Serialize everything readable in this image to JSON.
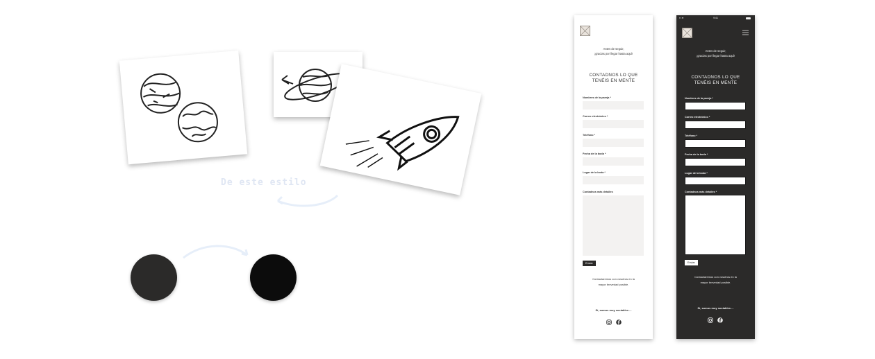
{
  "canvas": {
    "faint_label": "De este estilo"
  },
  "colors": {
    "circle_dark_gray": "#2b2a29",
    "circle_black": "#0c0c0c",
    "dark_background": "#2b2a29",
    "light_background": "#ffffff",
    "input_light": "#f3f2f1",
    "arrow_color": "#e8eef8"
  },
  "form": {
    "intro": [
      "Antes de seguir,",
      "¡gracias por llegar hasta aquí!"
    ],
    "title": [
      "CONTADNOS LO QUE",
      "TENÉIS EN MENTE"
    ],
    "fields": [
      {
        "label": "Nombres de la pareja *"
      },
      {
        "label": "Correo electrónico *"
      },
      {
        "label": "Teléfono *"
      },
      {
        "label": "Fecha de la boda *"
      },
      {
        "label": "Lugar de la boda *"
      }
    ],
    "textarea_label": "Contadnos más detalles",
    "textarea_label_dark": "Contadnos más detalles *",
    "send_label": "Enviar",
    "contact_text": [
      "Contactaremos con vosotros en la",
      "mayor brevedad posible."
    ],
    "social_text": "Sí, somos muy sociables ...",
    "social_icons": [
      "instagram-icon",
      "facebook-icon"
    ]
  },
  "statusbar": {
    "time": "9:41"
  }
}
